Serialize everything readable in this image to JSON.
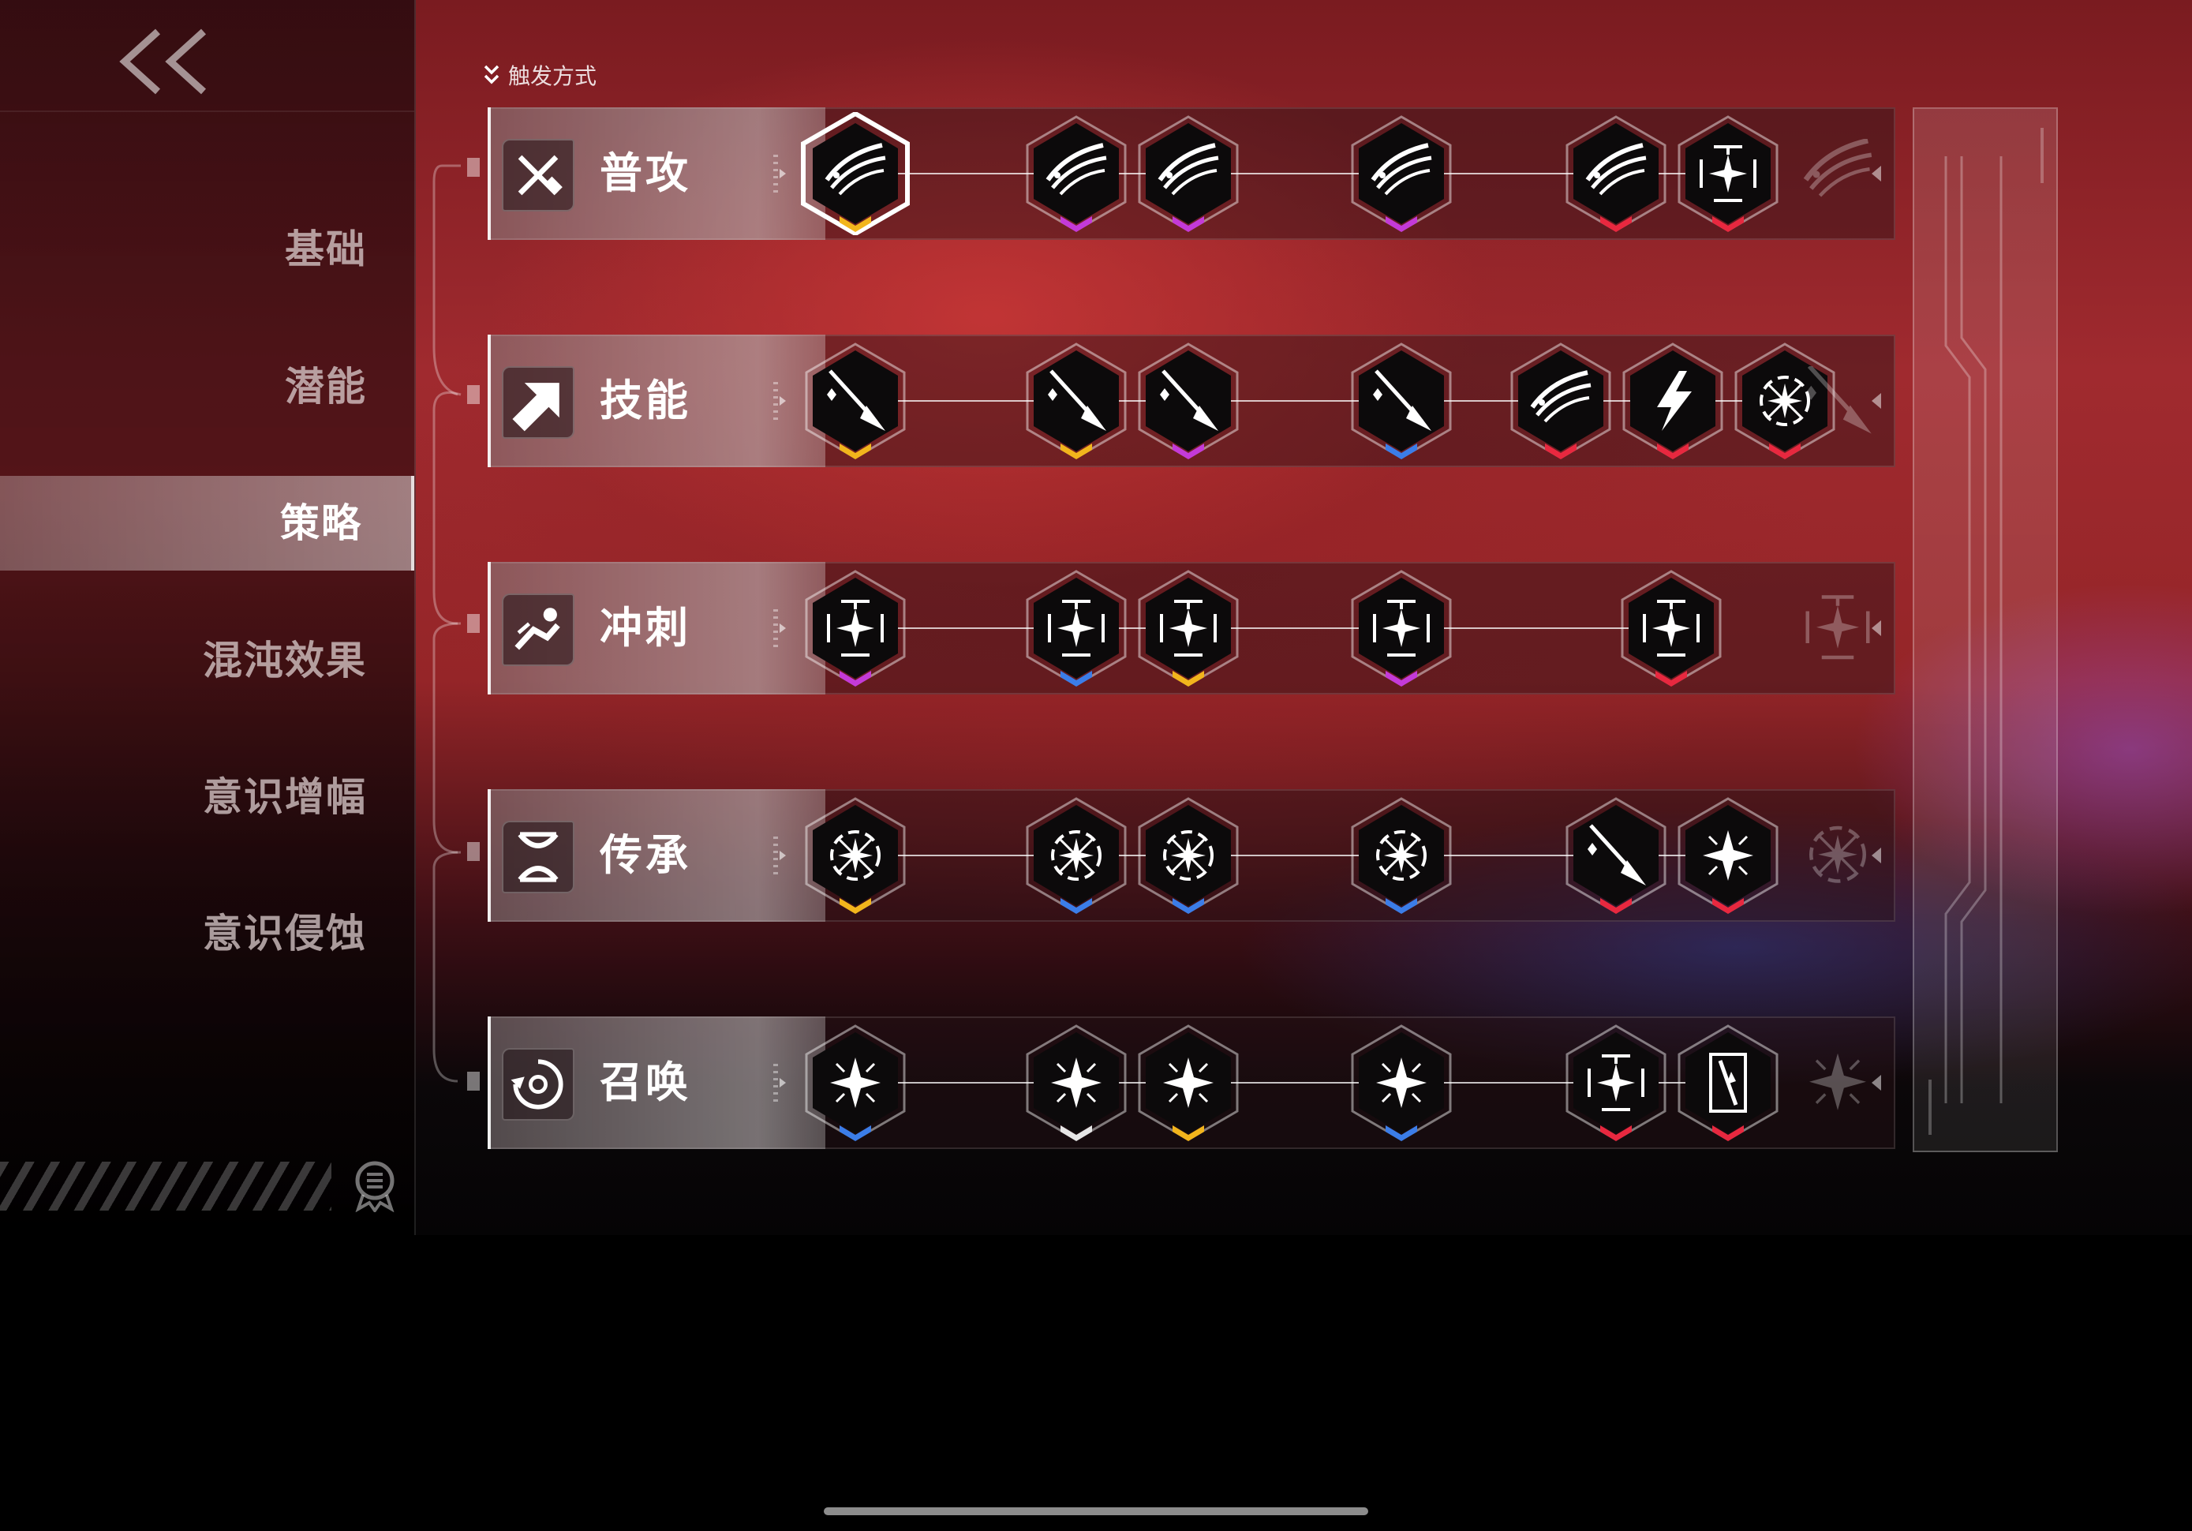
{
  "sidebar": {
    "items": [
      {
        "label": "基础"
      },
      {
        "label": "潜能"
      },
      {
        "label": "策略",
        "active": true
      },
      {
        "label": "混沌效果"
      },
      {
        "label": "意识增幅"
      },
      {
        "label": "意识侵蚀"
      }
    ]
  },
  "header": {
    "trigger_label": "触发方式"
  },
  "rows": [
    {
      "label": "普攻",
      "icon": "crossed-swords-icon",
      "nodes": [
        {
          "icon": "slash-icon",
          "rarity": "gold",
          "selected": true
        },
        {
          "icon": "slash-icon",
          "rarity": "purple"
        },
        {
          "icon": "slash-icon",
          "rarity": "purple"
        },
        {
          "icon": "slash-icon",
          "rarity": "purple"
        },
        {
          "icon": "slash-icon",
          "rarity": "red"
        },
        {
          "icon": "crosshair-icon",
          "rarity": "red"
        }
      ]
    },
    {
      "label": "技能",
      "icon": "arrow-up-right-icon",
      "nodes": [
        {
          "icon": "spear-icon",
          "rarity": "gold"
        },
        {
          "icon": "spear-icon",
          "rarity": "gold"
        },
        {
          "icon": "spear-icon",
          "rarity": "purple"
        },
        {
          "icon": "spear-icon",
          "rarity": "blue"
        },
        {
          "icon": "slash-icon",
          "rarity": "red"
        },
        {
          "icon": "lightning-icon",
          "rarity": "red"
        },
        {
          "icon": "burst-icon",
          "rarity": "red"
        }
      ]
    },
    {
      "label": "冲刺",
      "icon": "dash-icon",
      "nodes": [
        {
          "icon": "crosshair-icon",
          "rarity": "purple"
        },
        {
          "icon": "crosshair-icon",
          "rarity": "blue"
        },
        {
          "icon": "crosshair-icon",
          "rarity": "gold"
        },
        {
          "icon": "crosshair-icon",
          "rarity": "purple"
        },
        {
          "icon": "crosshair-icon",
          "rarity": "red"
        }
      ]
    },
    {
      "label": "传承",
      "icon": "dna-icon",
      "nodes": [
        {
          "icon": "burst-icon",
          "rarity": "gold"
        },
        {
          "icon": "burst-icon",
          "rarity": "blue"
        },
        {
          "icon": "burst-icon",
          "rarity": "blue"
        },
        {
          "icon": "burst-icon",
          "rarity": "blue"
        },
        {
          "icon": "spear-icon",
          "rarity": "red"
        },
        {
          "icon": "star-icon",
          "rarity": "red"
        }
      ]
    },
    {
      "label": "召唤",
      "icon": "summon-icon",
      "nodes": [
        {
          "icon": "star-icon",
          "rarity": "blue"
        },
        {
          "icon": "star-icon",
          "rarity": "white"
        },
        {
          "icon": "star-icon",
          "rarity": "gold"
        },
        {
          "icon": "star-icon",
          "rarity": "blue"
        },
        {
          "icon": "crosshair-icon",
          "rarity": "red"
        },
        {
          "icon": "pillar-icon",
          "rarity": "red"
        }
      ]
    }
  ],
  "colors": {
    "gold": "#f2b51c",
    "purple": "#c43ad8",
    "blue": "#3b7de8",
    "red": "#e8283f",
    "white": "#e6e6e6"
  }
}
